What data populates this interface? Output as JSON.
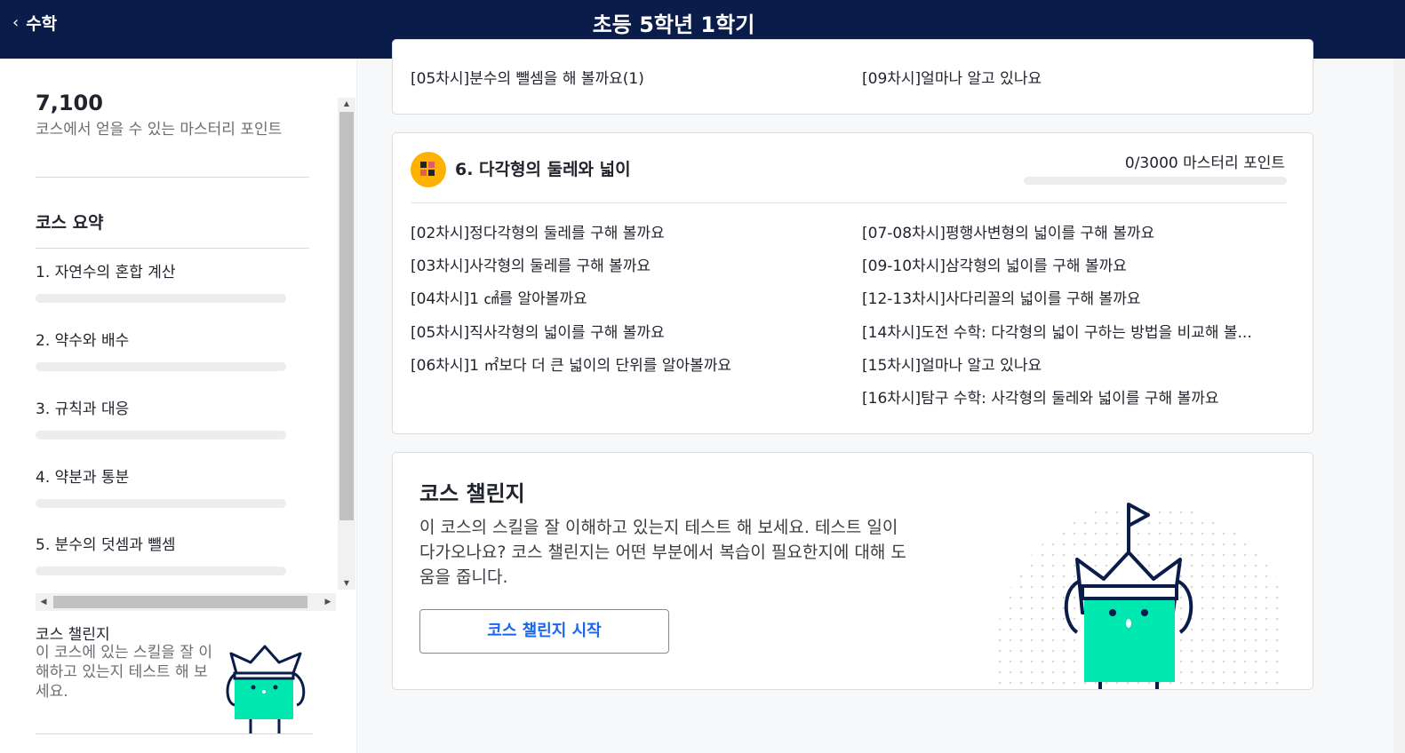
{
  "header": {
    "back_label": "수학",
    "title": "초등 5학년 1학기"
  },
  "sidebar": {
    "points_value": "7,100",
    "points_caption": "코스에서 얻을 수 있는 마스터리 포인트",
    "summary_title": "코스 요약",
    "units": [
      {
        "label": "1. 자연수의 혼합 계산",
        "progress": 0
      },
      {
        "label": "2. 약수와 배수",
        "progress": 0
      },
      {
        "label": "3. 규칙과 대응",
        "progress": 0
      },
      {
        "label": "4. 약분과 통분",
        "progress": 0
      },
      {
        "label": "5. 분수의 덧셈과 뺄셈",
        "progress": 0
      }
    ],
    "challenge_title": "코스 챌린지",
    "challenge_desc": "이 코스에 있는 스킬을 잘 이해하고 있는지 테스트 해 보세요."
  },
  "unit5_partial": {
    "lessons_left": [
      "[05차시]분수의 뺄셈을 해 볼까요(1)"
    ],
    "lessons_right": [
      "[09차시]얼마나 알고 있나요"
    ]
  },
  "unit6": {
    "icon": "calculator-icon",
    "badge_color": "#ffb100",
    "title": "6. 다각형의 둘레와 넓이",
    "points": "0/3000 마스터리 포인트",
    "progress": 0,
    "lessons_left": [
      "[02차시]정다각형의 둘레를 구해 볼까요",
      "[03차시]사각형의 둘레를 구해 볼까요",
      "[04차시]1 ㎠를 알아볼까요",
      "[05차시]직사각형의 넓이를 구해 볼까요",
      "[06차시]1 ㎡보다 더 큰 넓이의 단위를 알아볼까요"
    ],
    "lessons_right": [
      "[07-08차시]평행사변형의 넓이를 구해 볼까요",
      "[09-10차시]삼각형의 넓이를 구해 볼까요",
      "[12-13차시]사다리꼴의 넓이를 구해 볼까요",
      "[14차시]도전 수학: 다각형의 넓이 구하는 방법을 비교해 볼...",
      "[15차시]얼마나 알고 있나요",
      "[16차시]탐구 수학: 사각형의 둘레와 넓이를 구해 볼까요"
    ]
  },
  "course_challenge": {
    "title": "코스 챌린지",
    "description": "이 코스의 스킬을 잘 이해하고 있는지 테스트 해 보세요. 테스트 일이 다가오나요? 코스 챌린지는 어떤 부분에서 복습이 필요한지에 대해 도움을 줍니다.",
    "button_label": "코스 챌린지 시작"
  },
  "colors": {
    "header_bg": "#0a1d4a",
    "accent_blue": "#1865f2",
    "mascot_green": "#00e8b0",
    "mascot_outline": "#0a1d4a"
  }
}
